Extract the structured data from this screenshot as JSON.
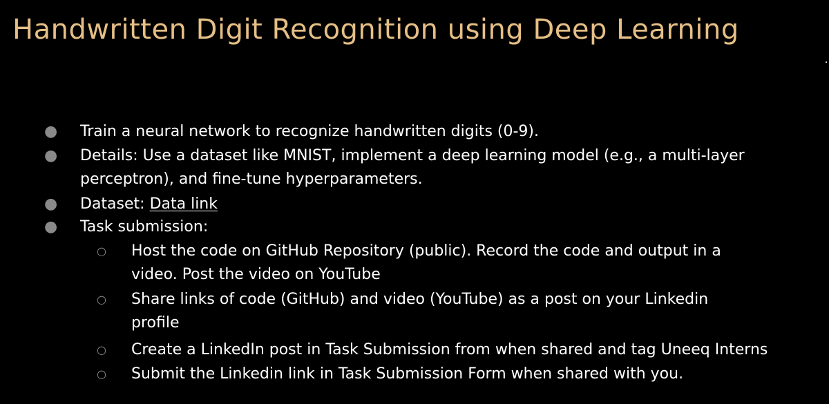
{
  "title": "Handwritten Digit Recognition using Deep Learning",
  "bullets": [
    {
      "text": "Train a neural network to recognize handwritten digits (0-9)."
    },
    {
      "lines": [
        "Details: Use a dataset like MNIST, implement a deep learning model (e.g., a multi-layer",
        "perceptron), and fine-tune hyperparameters."
      ]
    },
    {
      "text": "Dataset: ",
      "link_text": "Data link"
    },
    {
      "text": "Task submission:"
    }
  ],
  "sub_bullets": [
    {
      "lines": [
        "Host the code on GitHub Repository (public). Record the code and output in a",
        "video. Post the video on YouTube"
      ]
    },
    {
      "lines": [
        "Share links of code (GitHub) and video (YouTube) as a post on your Linkedin",
        "profile"
      ]
    },
    {
      "text": "Create a LinkedIn post in Task Submission from when shared and tag Uneeq Interns"
    },
    {
      "text": "Submit the Linkedin link in Task Submission Form when shared with you."
    }
  ],
  "icons": {
    "bullet_level1": "filled-circle",
    "bullet_level2": "hollow-circle"
  },
  "colors": {
    "background": "#000000",
    "title": "#e6bf86",
    "text": "#ffffff",
    "bullet": "#8a8a8a"
  }
}
